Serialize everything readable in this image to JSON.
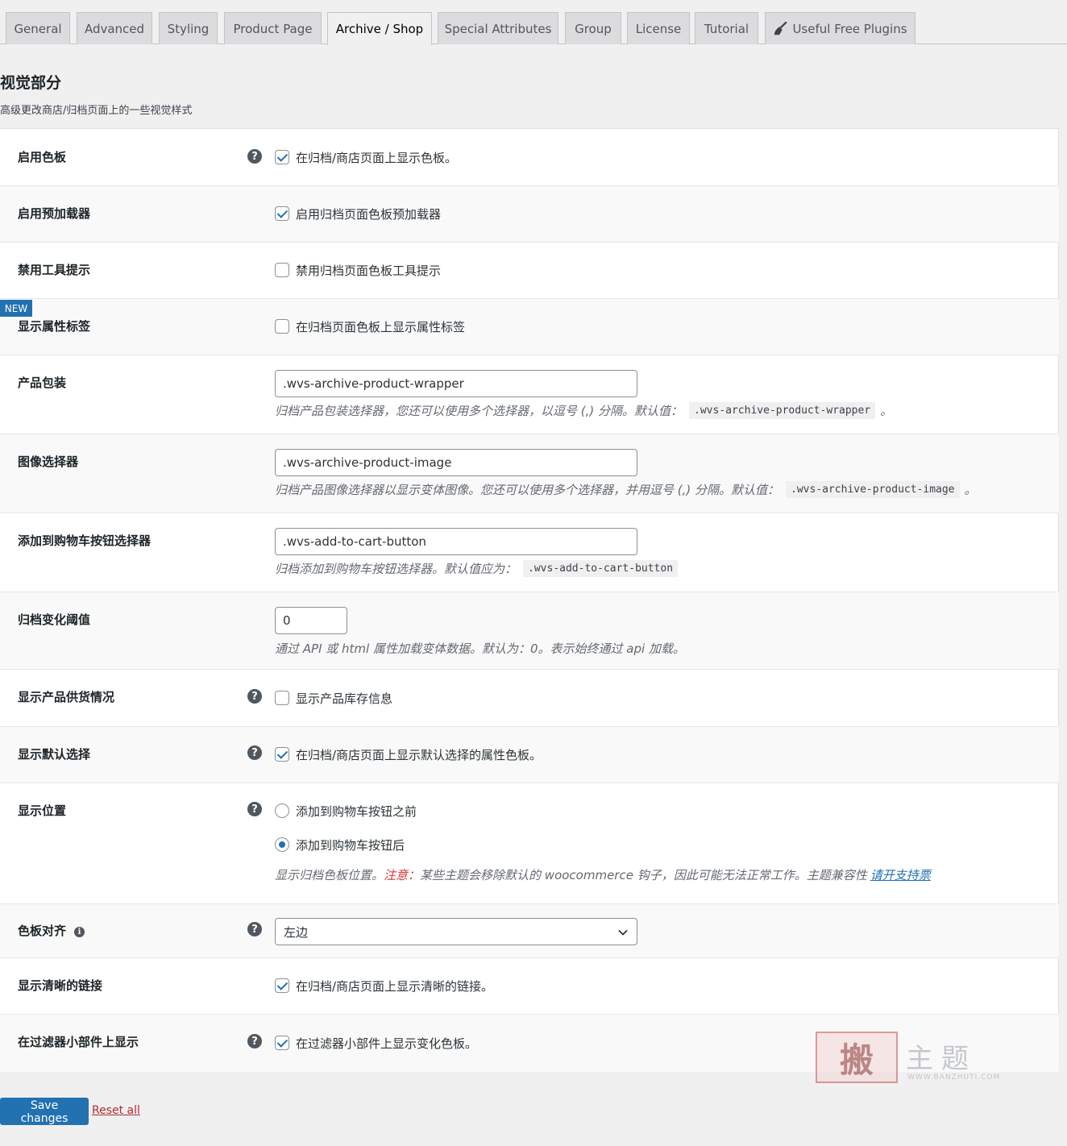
{
  "tabs": [
    {
      "label": "General"
    },
    {
      "label": "Advanced"
    },
    {
      "label": "Styling"
    },
    {
      "label": "Product Page"
    },
    {
      "label": "Archive / Shop"
    },
    {
      "label": "Special Attributes"
    },
    {
      "label": "Group"
    },
    {
      "label": "License"
    },
    {
      "label": "Tutorial"
    },
    {
      "label": "Useful Free Plugins",
      "icon": "broom-icon"
    }
  ],
  "active_tab": "Archive / Shop",
  "section": {
    "title": "视觉部分",
    "description": "高级更改商店/归档页面上的一些视觉样式"
  },
  "new_badge": "NEW",
  "settings": {
    "enable_swatches": {
      "label": "启用色板",
      "option": "在归档/商店页面上显示色板。",
      "checked": true
    },
    "enable_preloader": {
      "label": "启用预加载器",
      "option": "启用归档页面色板预加载器",
      "checked": true
    },
    "disable_tooltip": {
      "label": "禁用工具提示",
      "option": "禁用归档页面色板工具提示",
      "checked": false
    },
    "show_attribute_label": {
      "label": "显示属性标签",
      "option": "在归档页面色板上显示属性标签",
      "checked": false
    },
    "product_wrapper": {
      "label": "产品包装",
      "value": ".wvs-archive-product-wrapper",
      "desc": "归档产品包装选择器，您还可以使用多个选择器，以逗号 (,) 分隔。默认值：",
      "code": ".wvs-archive-product-wrapper",
      "suffix": "。"
    },
    "image_selector": {
      "label": "图像选择器",
      "value": ".wvs-archive-product-image",
      "desc": "归档产品图像选择器以显示变体图像。您还可以使用多个选择器，并用逗号 (,) 分隔。默认值：",
      "code": ".wvs-archive-product-image",
      "suffix": "。"
    },
    "cart_button_selector": {
      "label": "添加到购物车按钮选择器",
      "value": ".wvs-add-to-cart-button",
      "desc": "归档添加到购物车按钮选择器。默认值应为：",
      "code": ".wvs-add-to-cart-button"
    },
    "variation_threshold": {
      "label": "归档变化阈值",
      "value": "0",
      "desc": "通过 API 或 html 属性加载变体数据。默认为：0。表示始终通过 api 加载。"
    },
    "show_stock": {
      "label": "显示产品供货情况",
      "option": "显示产品库存信息",
      "checked": false
    },
    "show_default_selected": {
      "label": "显示默认选择",
      "option": "在归档/商店页面上显示默认选择的属性色板。",
      "checked": true
    },
    "display_position": {
      "label": "显示位置",
      "options": [
        "添加到购物车按钮之前",
        "添加到购物车按钮后"
      ],
      "selected": 1,
      "desc_before": "显示归档色板位置。",
      "note": "注意：",
      "desc_after": "某些主题会移除默认的 woocommerce 钩子，因此可能无法正常工作。主题兼容性",
      "link": "请开支持票"
    },
    "swatch_align": {
      "label": "色板对齐",
      "selected": "左边"
    },
    "show_clear_link": {
      "label": "显示清晰的链接",
      "option": "在归档/商店页面上显示清晰的链接。",
      "checked": true
    },
    "show_on_filter_widget": {
      "label": "在过滤器小部件上显示",
      "option": "在过滤器小部件上显示变化色板。",
      "checked": true
    }
  },
  "actions": {
    "save": "Save changes",
    "reset": "Reset all"
  },
  "watermark": {
    "mark": "搬",
    "text": "主题",
    "url": "WWW.BANZHUTI.COM"
  },
  "colors": {
    "accent": "#2271b1",
    "background": "#f0f0f1",
    "reset": "#b32d2e",
    "note": "#d63638"
  }
}
